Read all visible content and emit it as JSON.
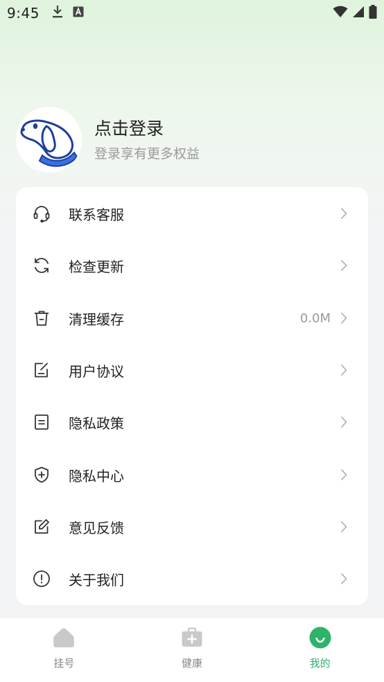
{
  "status_bar": {
    "time": "9:45",
    "icons": [
      "download-icon",
      "a-box-icon",
      "wifi-icon",
      "signal-icon",
      "battery-icon"
    ]
  },
  "profile": {
    "title": "点击登录",
    "subtitle": "登录享有更多权益"
  },
  "menu": {
    "items": [
      {
        "label": "联系客服",
        "icon": "headset-icon"
      },
      {
        "label": "检查更新",
        "icon": "refresh-icon"
      },
      {
        "label": "清理缓存",
        "icon": "trash-icon",
        "value": "0.0M"
      },
      {
        "label": "用户协议",
        "icon": "agreement-icon"
      },
      {
        "label": "隐私政策",
        "icon": "document-icon"
      },
      {
        "label": "隐私中心",
        "icon": "shield-plus-icon"
      },
      {
        "label": "意见反馈",
        "icon": "edit-icon"
      },
      {
        "label": "关于我们",
        "icon": "info-icon"
      }
    ]
  },
  "tabs": [
    {
      "label": "挂号",
      "icon": "home-icon",
      "active": false
    },
    {
      "label": "健康",
      "icon": "medkit-icon",
      "active": false
    },
    {
      "label": "我的",
      "icon": "smile-icon",
      "active": true
    }
  ],
  "colors": {
    "accent": "#2fb36a",
    "text": "#222222",
    "muted": "#9a9a9a"
  }
}
